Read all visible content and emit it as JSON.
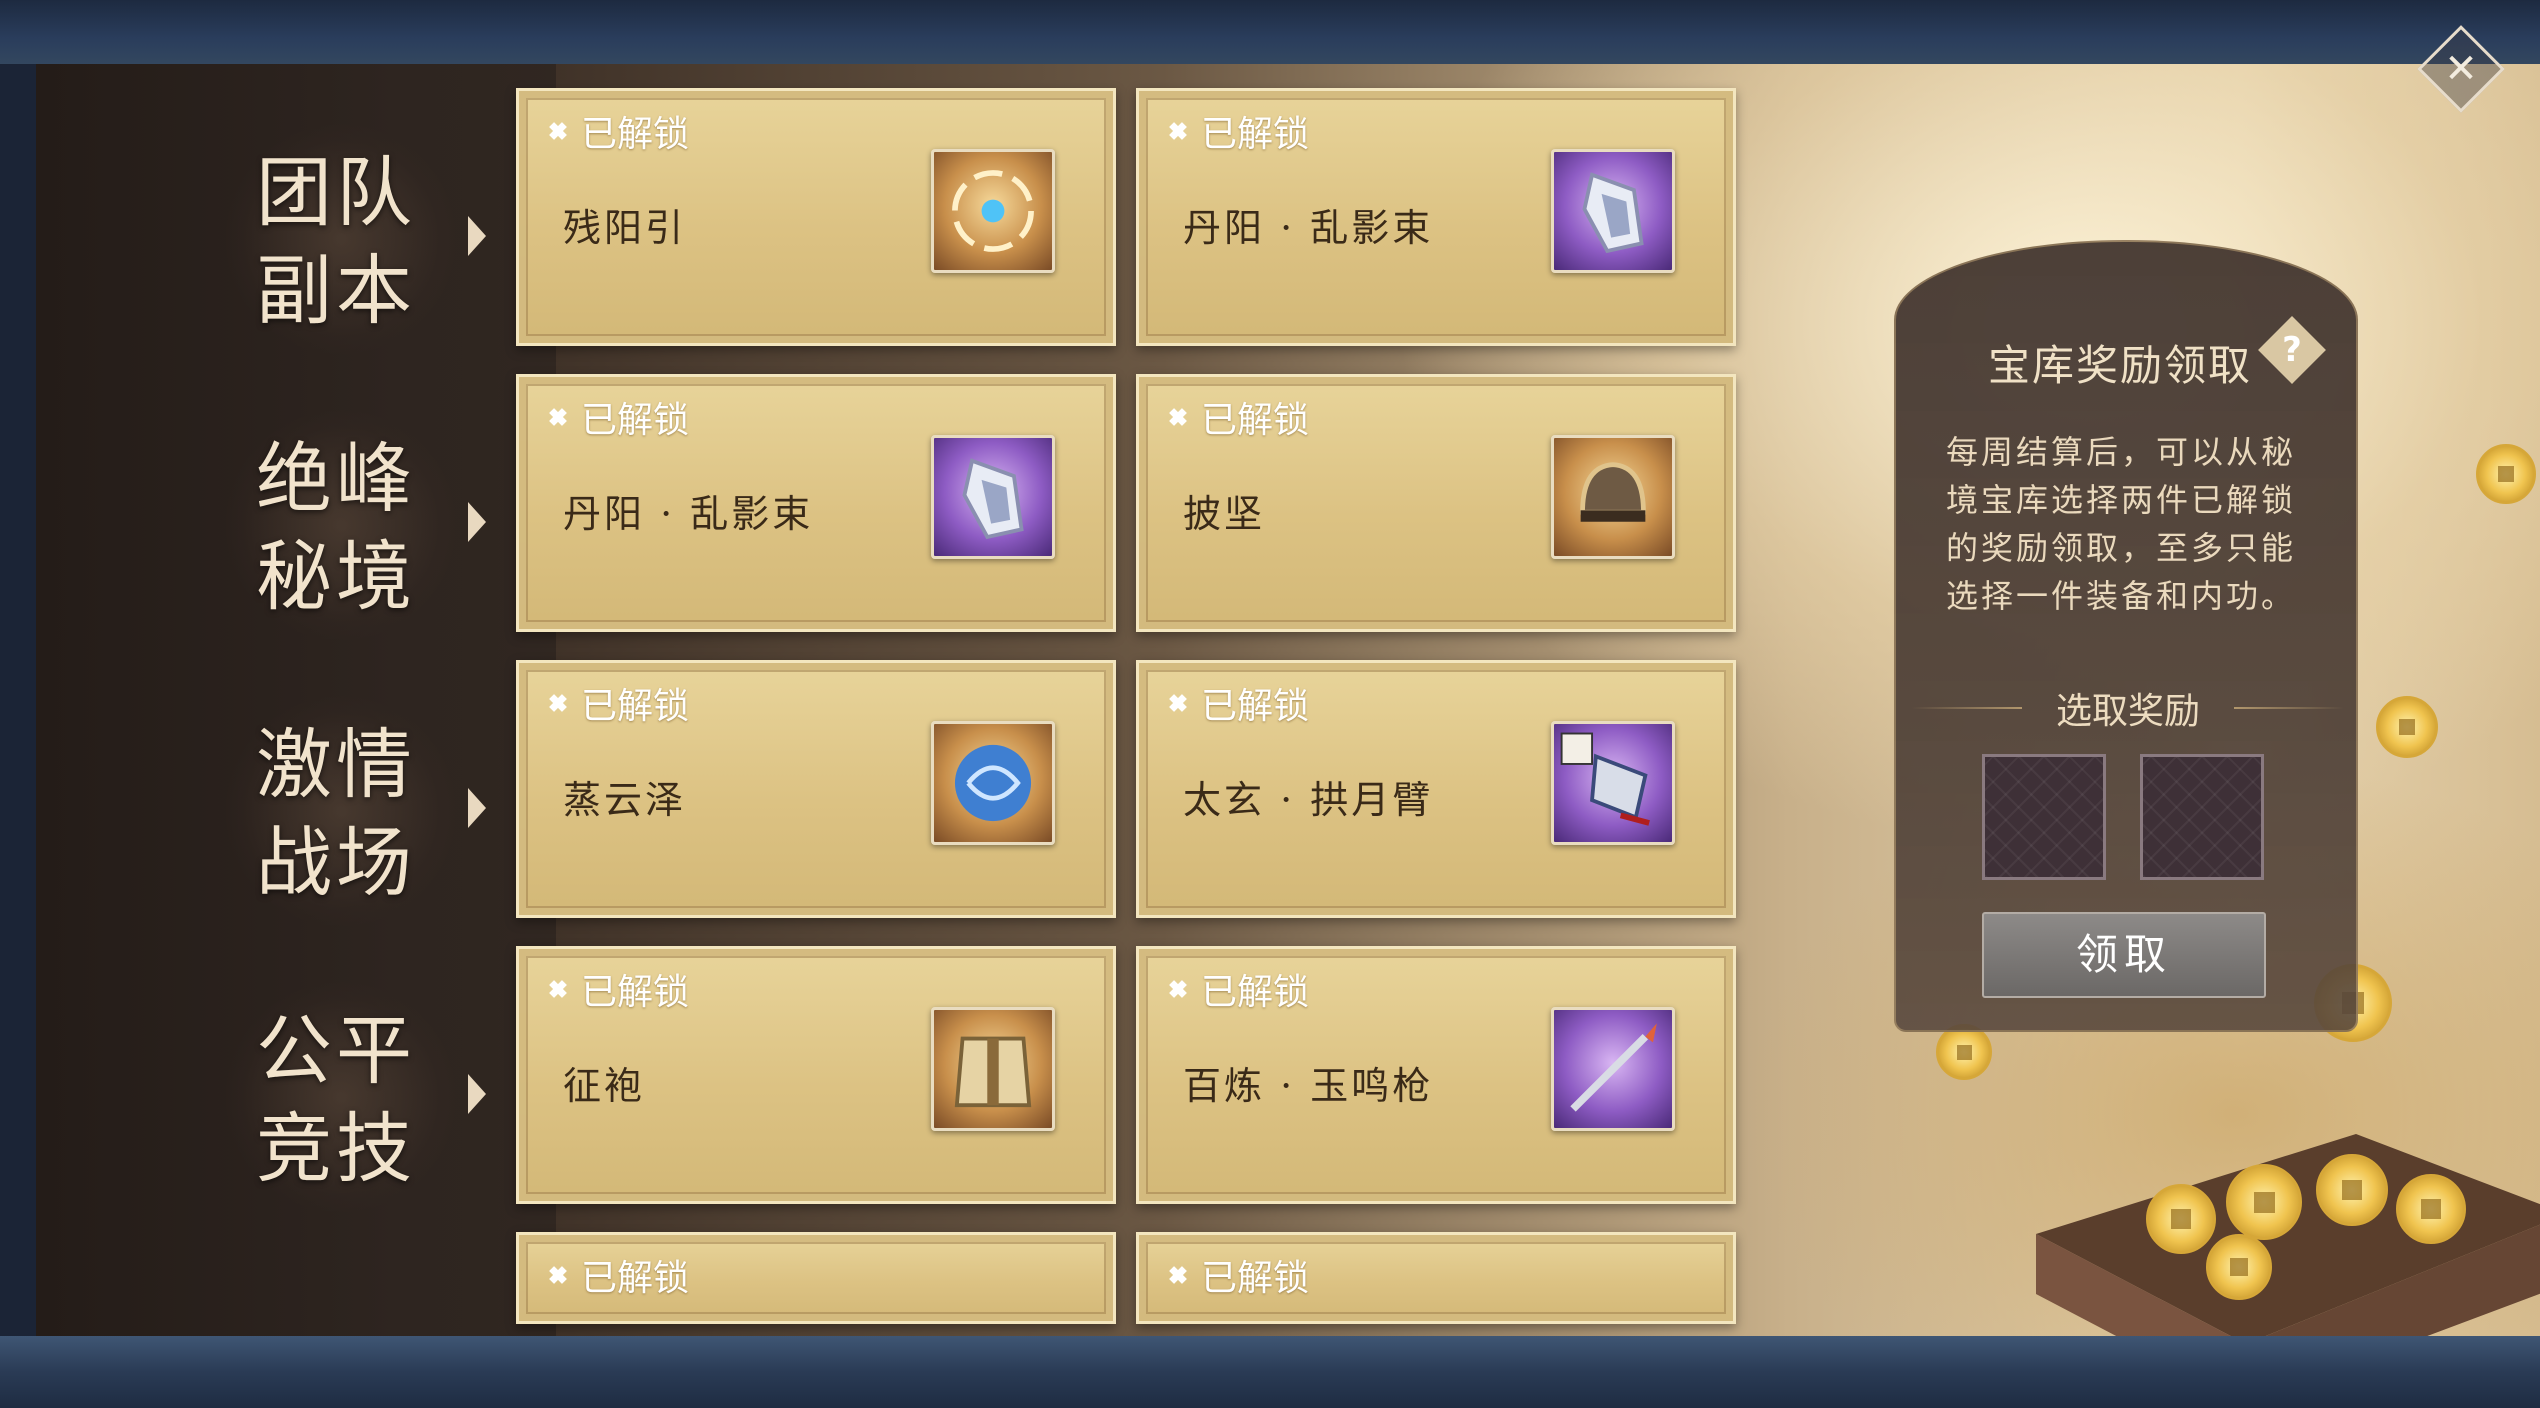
{
  "categories": [
    {
      "label": "团队\n副本"
    },
    {
      "label": "绝峰\n秘境"
    },
    {
      "label": "激情\n战场"
    },
    {
      "label": "公平\n竞技"
    }
  ],
  "cards": [
    {
      "status": "已解锁",
      "name": "残阳引",
      "icon": "swirl-orb-icon",
      "rarity": "gold"
    },
    {
      "status": "已解锁",
      "name": "丹阳 · 乱影束",
      "icon": "bracer-icon",
      "rarity": "purple"
    },
    {
      "status": "已解锁",
      "name": "丹阳 · 乱影束",
      "icon": "bracer-icon",
      "rarity": "purple"
    },
    {
      "status": "已解锁",
      "name": "披坚",
      "icon": "helmet-icon",
      "rarity": "gold"
    },
    {
      "status": "已解锁",
      "name": "蒸云泽",
      "icon": "water-orb-icon",
      "rarity": "gold"
    },
    {
      "status": "已解锁",
      "name": "太玄 · 拱月臂",
      "icon": "arm-guard-icon",
      "rarity": "purple"
    },
    {
      "status": "已解锁",
      "name": "征袍",
      "icon": "armor-robe-icon",
      "rarity": "gold"
    },
    {
      "status": "已解锁",
      "name": "百炼 · 玉鸣枪",
      "icon": "spear-icon",
      "rarity": "purple"
    },
    {
      "status": "已解锁"
    },
    {
      "status": "已解锁"
    }
  ],
  "reward_panel": {
    "title": "宝库奖励领取",
    "help": "?",
    "description": "每周结算后，可以从秘境宝库选择两件已解锁的奖励领取，至多只能选择一件装备和内功。",
    "select_title": "选取奖励",
    "claim_button": "领取"
  },
  "close_button": "✕",
  "colors": {
    "card_gold": "#dcc283",
    "panel_dark": "#3f322c",
    "claim_gray": "#7a7776"
  }
}
